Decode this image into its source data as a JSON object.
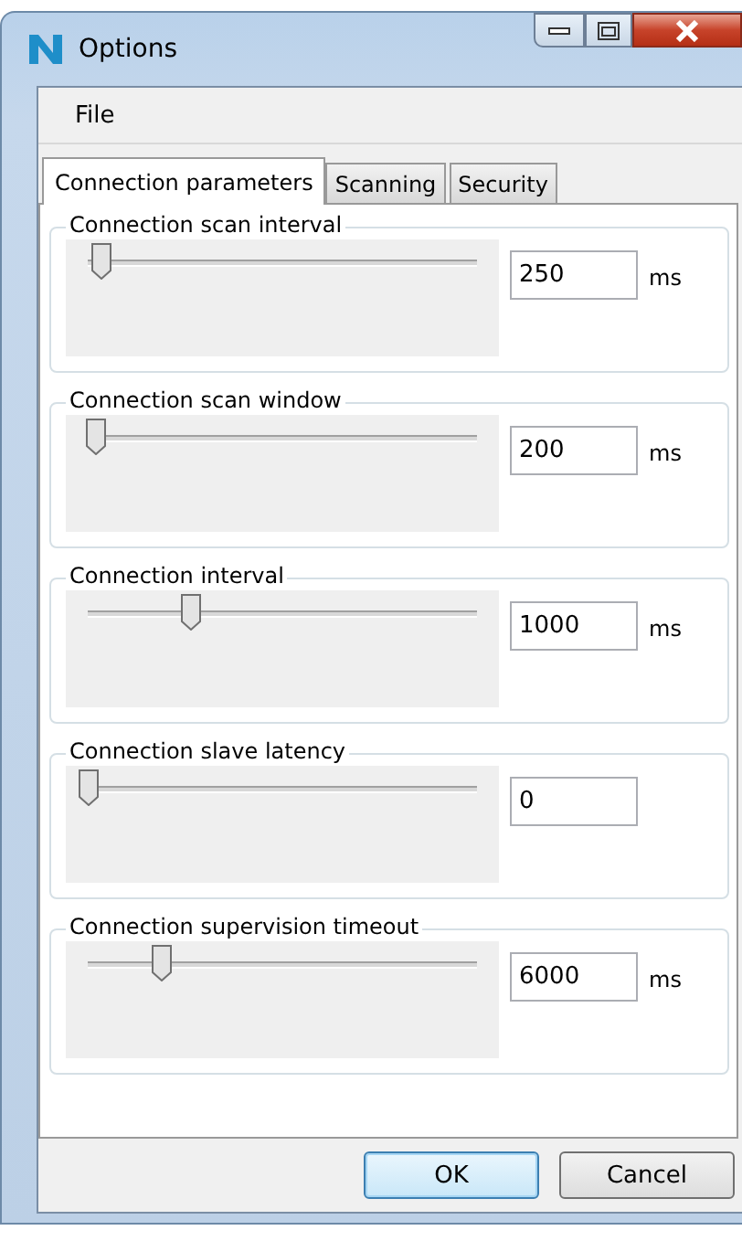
{
  "window": {
    "title": "Options"
  },
  "menu": [
    "File"
  ],
  "tabs": [
    {
      "label": "Connection parameters",
      "selected": true
    },
    {
      "label": "Scanning",
      "selected": false
    },
    {
      "label": "Security",
      "selected": false
    }
  ],
  "groups": [
    {
      "title": "Connection scan interval",
      "level": 0.03,
      "value": "250",
      "unit": "ms"
    },
    {
      "title": "Connection scan window",
      "level": 0.02,
      "value": "200",
      "unit": "ms"
    },
    {
      "title": "Connection interval",
      "level": 0.25,
      "value": "1000",
      "unit": "ms"
    },
    {
      "title": "Connection slave latency",
      "level": 0,
      "value": "0"
    },
    {
      "title": "Connection supervision timeout",
      "level": 0.18,
      "value": "6000",
      "unit": "ms"
    }
  ],
  "buttons": [
    {
      "label": "OK",
      "focused": true
    },
    {
      "label": "Cancel",
      "focused": false
    }
  ]
}
